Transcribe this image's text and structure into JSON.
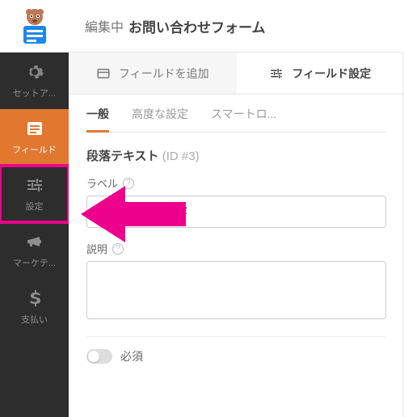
{
  "header": {
    "prefix": "編集中",
    "title": "お問い合わせフォーム"
  },
  "nav": {
    "setup": "セットア...",
    "fields": "フィールド",
    "settings": "設定",
    "marketing": "マーケテ...",
    "payments": "支払い"
  },
  "top_tabs": {
    "add_field": "フィールドを追加",
    "field_settings": "フィールド設定"
  },
  "sub_tabs": {
    "general": "一般",
    "advanced": "高度な設定",
    "smart": "スマートロ..."
  },
  "field_type": {
    "name": "段落テキスト",
    "id": "(ID #3)"
  },
  "rows": {
    "label": {
      "label": "ラベル",
      "value": "お問い合わせ内容"
    },
    "description": {
      "label": "説明",
      "value": ""
    }
  },
  "required_label": "必須",
  "help_glyph": "?"
}
